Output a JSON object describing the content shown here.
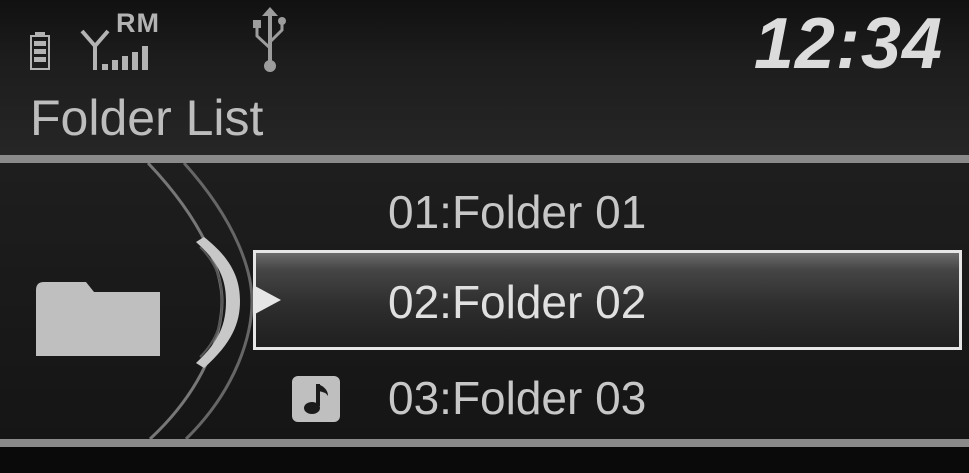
{
  "status": {
    "roaming_label": "RM",
    "battery_icon": "battery-icon",
    "signal_icon": "signal-antenna-icon",
    "usb_icon": "usb-icon",
    "clock": "12:34"
  },
  "title": "Folder List",
  "folders": [
    {
      "label": "01:Folder 01",
      "selected": false,
      "icon": ""
    },
    {
      "label": "02:Folder 02",
      "selected": true,
      "icon": "pointer-arrow-icon"
    },
    {
      "label": "03:Folder 03",
      "selected": false,
      "icon": "music-note-icon"
    }
  ],
  "colors": {
    "background": "#1a1a1a",
    "text": "#c7c7c7",
    "divider": "#8a8a8a",
    "selection_border": "#e6e6e6"
  }
}
